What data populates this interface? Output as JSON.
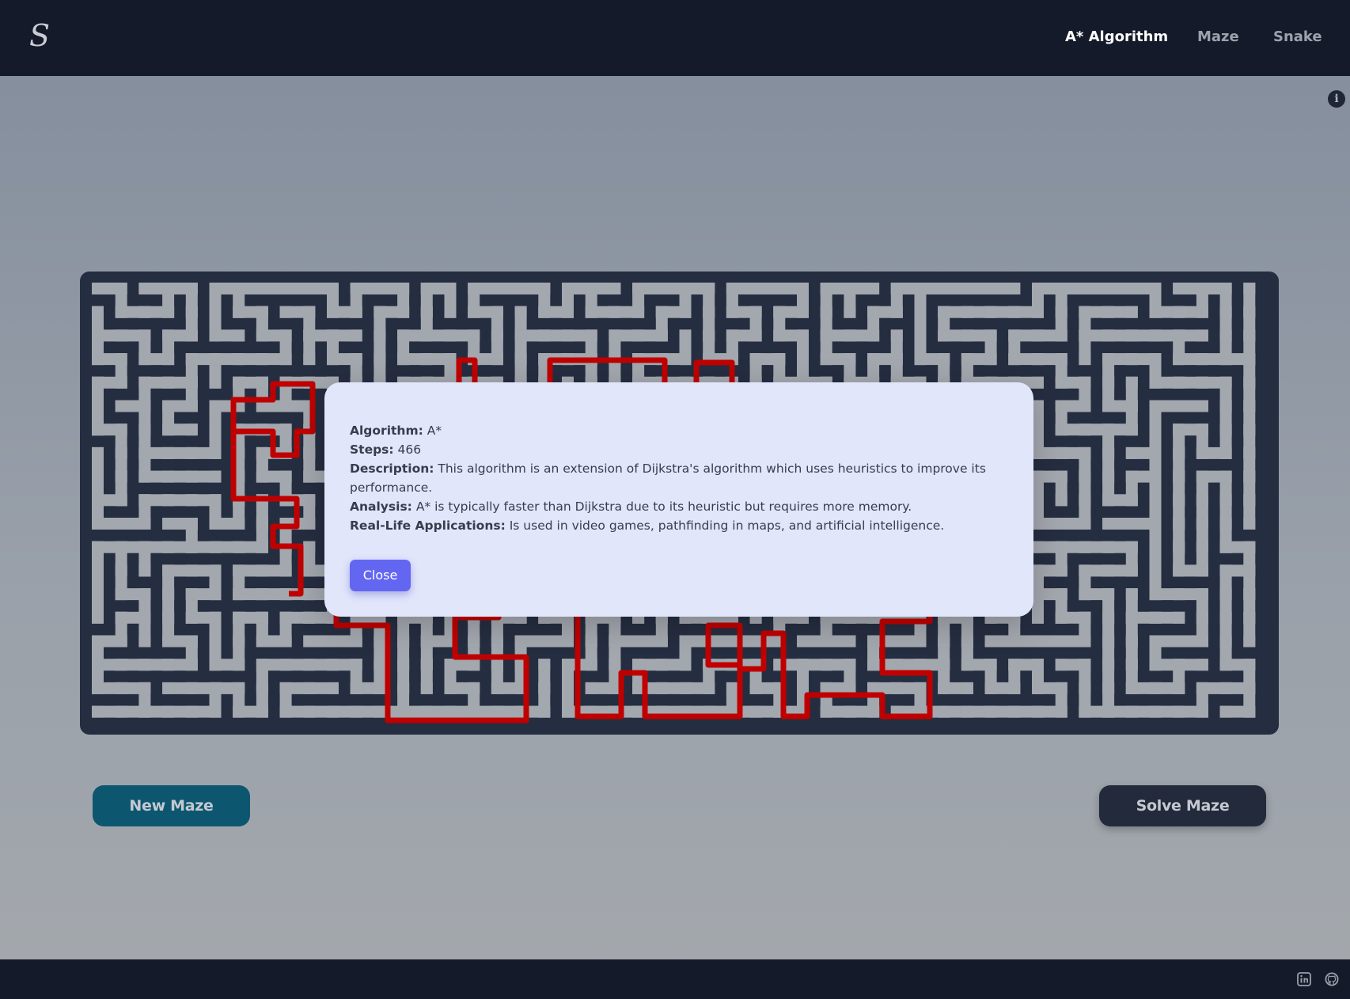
{
  "app": {
    "logo_text": "S"
  },
  "nav": {
    "items": [
      {
        "label": "A* Algorithm",
        "active": true
      },
      {
        "label": "Maze",
        "active": false
      },
      {
        "label": "Snake",
        "active": false
      }
    ]
  },
  "info_icon": "info-circle-icon",
  "maze": {
    "wall_color": "#252d40",
    "path_color": "#a3a7ae",
    "solution_color": "#c00000"
  },
  "buttons": {
    "new_maze": "New Maze",
    "solve_maze": "Solve Maze"
  },
  "modal": {
    "algorithm_label": "Algorithm:",
    "algorithm_value": "A*",
    "steps_label": "Steps:",
    "steps_value": "466",
    "description_label": "Description:",
    "description_value": "This algorithm is an extension of Dijkstra's algorithm which uses heuristics to improve its performance.",
    "analysis_label": "Analysis:",
    "analysis_value": "A* is typically faster than Dijkstra due to its heuristic but requires more memory.",
    "applications_label": "Real-Life Applications:",
    "applications_value": "Is used in video games, pathfinding in maps, and artificial intelligence.",
    "close_label": "Close"
  },
  "footer": {
    "icons": [
      "linkedin-icon",
      "github-icon"
    ]
  }
}
